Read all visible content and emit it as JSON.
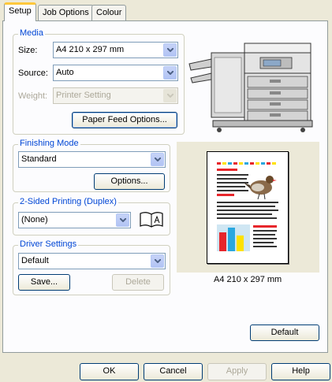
{
  "tabs": [
    {
      "label": "Setup",
      "active": true
    },
    {
      "label": "Job Options",
      "active": false
    },
    {
      "label": "Colour",
      "active": false
    }
  ],
  "media": {
    "title": "Media",
    "size_label": "Size:",
    "size_value": "A4 210 x 297 mm",
    "source_label": "Source:",
    "source_value": "Auto",
    "weight_label": "Weight:",
    "weight_value": "Printer Setting",
    "paper_feed_button": "Paper Feed Options..."
  },
  "finishing": {
    "title": "Finishing Mode",
    "value": "Standard",
    "options_button": "Options..."
  },
  "duplex": {
    "title": "2-Sided Printing (Duplex)",
    "value": "(None)"
  },
  "driver": {
    "title": "Driver Settings",
    "value": "Default",
    "save_button": "Save...",
    "delete_button": "Delete"
  },
  "preview": {
    "caption": "A4 210 x 297 mm"
  },
  "default_button": "Default",
  "footer": {
    "ok": "OK",
    "cancel": "Cancel",
    "apply": "Apply",
    "help": "Help"
  },
  "colors": {
    "group_title": "#0046d5",
    "tab_highlight": "#ffc83c",
    "dialog_bg": "#ece9d8",
    "panel_bg": "#fcfcfe"
  }
}
